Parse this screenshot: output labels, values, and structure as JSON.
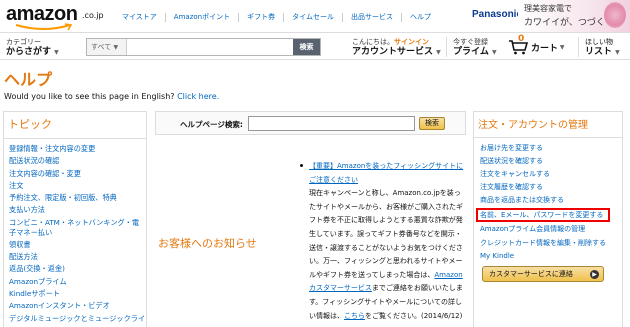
{
  "header": {
    "logo_text": "amazon",
    "logo_suffix": ".co.jp",
    "top_links": [
      "マイストア",
      "Amazonポイント",
      "ギフト券",
      "タイムセール",
      "出品サービス",
      "ヘルプ"
    ],
    "ad": {
      "brand": "Panasonic",
      "line1": "理美容家電で",
      "line2": "カワイイが、つづく"
    }
  },
  "nav": {
    "category_small": "カテゴリー",
    "category_big": "からさがす",
    "search_category": "すべて",
    "search_placeholder": "",
    "search_button": "検索",
    "account_small_prefix": "こんにちは。",
    "account_small_link": "サインイン",
    "account_big": "アカウントサービス",
    "prime_small": "今すぐ登録",
    "prime_big": "プライム",
    "cart_count": "0",
    "cart_label": "カート",
    "list_small": "ほしい物",
    "list_big": "リスト"
  },
  "page": {
    "title": "ヘルプ",
    "english_prompt": "Would you like to see this page in English?",
    "english_link": "Click here."
  },
  "left_panel": {
    "title": "トピック",
    "items": [
      "登録情報・注文内容の変更",
      "配送状況の確認",
      "注文内容の確認・変更",
      "注文",
      "予約注文、限定版・初回版、特典",
      "支払い方法",
      "コンビニ・ATM・ネットバンキング・電子マネー払い",
      "領収書",
      "配送方法",
      "返品(交換・返金)",
      "Amazonプライム",
      "Kindleサポート",
      "Amazonインスタント・ビデオ",
      "デジタルミュージックとミュージックライブ"
    ]
  },
  "help_search": {
    "label": "ヘルプページ検索:",
    "button": "検索"
  },
  "notice": {
    "heading": "お客様へのお知らせ",
    "news_link": "【重要】Amazonを装ったフィッシングサイトにご注意ください",
    "news_body_1": "現在キャンペーンと称し、Amazon.co.jpを装ったサイトやメールから、お客様がご購入されたギフト券を不正に取得しようとする悪質な詐欺が発生しています。誤ってギフト券番号などを開示・送信・譲渡することがないようお気をつけください。万一、フィッシングと思われるサイトやメールやギフト券を送ってしまった場合は、",
    "news_link_2": "Amazonカスタマーサービス",
    "news_body_2": "までご連絡をお願いいたします。フィッシングサイトやメールについての詳しい情報は、",
    "news_link_3": "こちら",
    "news_body_3": "をご覧ください。(2014/6/12)"
  },
  "right_panel": {
    "title": "注文・アカウントの管理",
    "items": [
      "お届け先を変更する",
      "配送状況を確認する",
      "注文をキャンセルする",
      "注文履歴を確認する",
      "商品を返品または交換する",
      "名前、Eメール、パスワードを変更する",
      "Amazonプライム会員情報の管理",
      "クレジットカード情報を編集・削除する",
      "My Kindle"
    ],
    "highlighted_index": 5,
    "cs_button": "カスタマーサービスに連絡",
    "highlight_color": "#e00000"
  },
  "colors": {
    "accent": "#e47911",
    "link": "#0066c0"
  }
}
